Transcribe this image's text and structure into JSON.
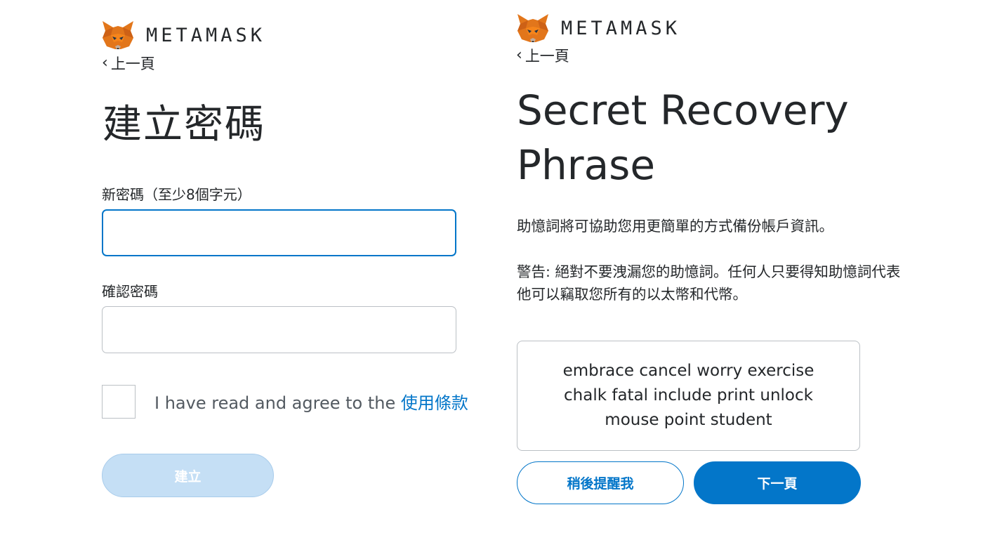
{
  "brand": {
    "wordmark": "METAMASK",
    "colors": {
      "primary": "#0376c9",
      "primary_disabled": "#c5dff5",
      "text": "#24272a",
      "border": "#bbc0c5",
      "fox_orange": "#e2761b"
    }
  },
  "create_password_screen": {
    "back_label": "上一頁",
    "title": "建立密碼",
    "new_password": {
      "label": "新密碼（至少8個字元）",
      "value": "",
      "focused": true
    },
    "confirm_password": {
      "label": "確認密碼",
      "value": ""
    },
    "agree": {
      "checked": false,
      "text": "I have read and agree to the ",
      "terms_link": "使用條款"
    },
    "create_button": "建立",
    "create_button_disabled": true
  },
  "secret_phrase_screen": {
    "back_label": "上一頁",
    "title": "Secret Recovery Phrase",
    "description": "助憶詞將可協助您用更簡單的方式備份帳戶資訊。",
    "warning": "警告: 絕對不要洩漏您的助憶詞。任何人只要得知助憶詞代表他可以竊取您所有的以太幣和代幣。",
    "phrase": "embrace cancel worry exercise chalk fatal include print unlock mouse point student",
    "remind_later_button": "稍後提醒我",
    "next_button": "下一頁"
  },
  "icons": {
    "logo": "metamask-fox-icon",
    "back": "chevron-left-icon"
  }
}
